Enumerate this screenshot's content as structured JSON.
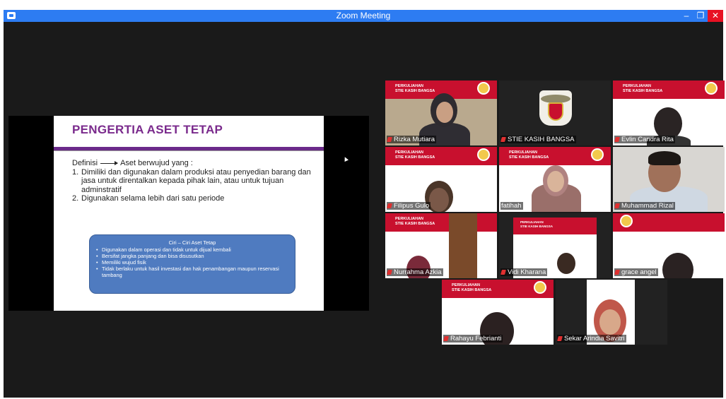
{
  "window": {
    "title": "Zoom Meeting",
    "min_glyph": "–",
    "max_glyph": "❐",
    "close_glyph": "✕"
  },
  "slide": {
    "title": "PENGERTIA ASET TETAP",
    "definisi_label": "Definisi",
    "definisi_text": "Aset berwujud yang :",
    "items": [
      {
        "num": "1.",
        "text": "Dimiliki dan digunakan dalam produksi atau penyedian barang dan jasa untuk direntalkan kepada pihak lain, atau untuk tujuan adminstratif"
      },
      {
        "num": "2.",
        "text": "Digunakan selama lebih dari satu periode"
      }
    ],
    "ciri": {
      "title": "Ciri – Ciri Aset Tetap",
      "bullets": [
        "Digunakan dalam operasi dan tidak untuk dijual kembali",
        "Bersifat jangka panjang dan bisa disusutkan",
        "Memiliki wujud fisik",
        "Tidak berlaku untuk hasil investasi dan hak penambangan maupun reservasi tambang"
      ]
    }
  },
  "banner": {
    "line1": "PERKULIAHAN",
    "line2": "STIE KASIH BANGSA"
  },
  "participants": [
    {
      "name": "Rizka Mutiara"
    },
    {
      "name": "STIE KASIH BANGSA"
    },
    {
      "name": "Evlin Candra Rita"
    },
    {
      "name": "Filipus Gulo"
    },
    {
      "name": "fatihah"
    },
    {
      "name": "Muhammad Rizal"
    },
    {
      "name": "Nurrahma Azkia"
    },
    {
      "name": "Vidi Kharana"
    },
    {
      "name": "grace angel"
    },
    {
      "name": "Rahayu Febrianti"
    },
    {
      "name": "Sekar Arindia Savitri"
    }
  ],
  "colors": {
    "titlebar": "#2d7cf2",
    "close": "#e81123",
    "slide_title": "#7a2a8c",
    "banner": "#c8102e",
    "ciri_box": "#4f7bc0",
    "active_speaker": "#c9d23b"
  }
}
